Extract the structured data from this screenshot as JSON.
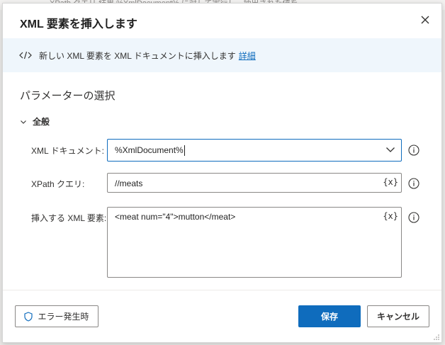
{
  "background": {
    "strip_text": "XPath クエリ 結果 %XmlDocument% に対して実行し、抽出された値を"
  },
  "dialog": {
    "title": "XML 要素を挿入します",
    "banner_text": "新しい XML 要素を XML ドキュメントに挿入します",
    "banner_link": "詳細",
    "section_title": "パラメーターの選択",
    "group_label": "全般"
  },
  "fields": {
    "xml_document": {
      "label": "XML ドキュメント:",
      "value": "%XmlDocument%"
    },
    "xpath_query": {
      "label": "XPath クエリ:",
      "value": "//meats",
      "var_button": "{x}"
    },
    "xml_element": {
      "label": "挿入する XML 要素:",
      "value": "<meat num=\"4\">mutton</meat>",
      "var_button": "{x}"
    }
  },
  "footer": {
    "error_button": "エラー発生時",
    "save_button": "保存",
    "cancel_button": "キャンセル"
  },
  "colors": {
    "accent": "#0f6cbd",
    "banner_bg": "#eff6fc"
  },
  "icons": [
    "close-icon",
    "code-icon",
    "chevron-down-icon",
    "info-icon",
    "shield-icon",
    "resize-grip-icon"
  ]
}
